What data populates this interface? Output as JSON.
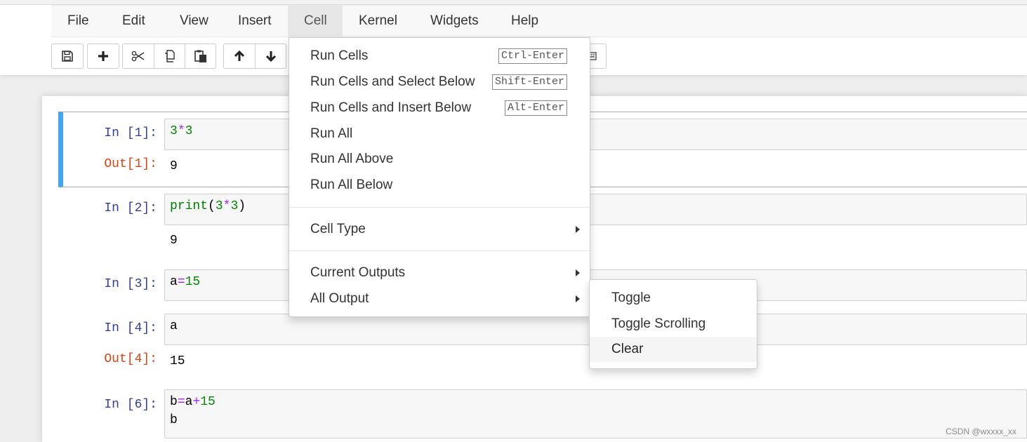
{
  "menubar": {
    "items": [
      "File",
      "Edit",
      "View",
      "Insert",
      "Cell",
      "Kernel",
      "Widgets",
      "Help"
    ],
    "active": "Cell"
  },
  "toolbar": {
    "icons": [
      "save-icon",
      "plus-icon",
      "scissors-icon",
      "copy-icon",
      "paste-icon",
      "arrow-up-icon",
      "arrow-down-icon",
      "keyboard-icon"
    ]
  },
  "cells": [
    {
      "in_prompt": "In [1]:",
      "code": [
        [
          "3",
          "*",
          "3"
        ]
      ],
      "out_prompt": "Out[1]:",
      "output": "9",
      "selected": true
    },
    {
      "in_prompt": "In [2]:",
      "code": [
        [
          "print",
          "(",
          "3",
          "*",
          "3",
          ")"
        ]
      ],
      "out_prompt": "",
      "output": "9"
    },
    {
      "in_prompt": "In [3]:",
      "code": [
        [
          "a",
          "=",
          "15"
        ]
      ]
    },
    {
      "in_prompt": "In [4]:",
      "code": [
        [
          "a"
        ]
      ],
      "out_prompt": "Out[4]:",
      "output": "15"
    },
    {
      "in_prompt": "In [6]:",
      "code": [
        [
          "b",
          "=",
          "a",
          "+",
          "15"
        ],
        [
          "b"
        ]
      ]
    }
  ],
  "cell_menu": {
    "items": [
      {
        "label": "Run Cells",
        "shortcut": "Ctrl-Enter"
      },
      {
        "label": "Run Cells and Select Below",
        "shortcut": "Shift-Enter"
      },
      {
        "label": "Run Cells and Insert Below",
        "shortcut": "Alt-Enter"
      },
      {
        "label": "Run All"
      },
      {
        "label": "Run All Above"
      },
      {
        "label": "Run All Below"
      },
      {
        "label": "Cell Type"
      },
      {
        "label": "Current Outputs"
      },
      {
        "label": "All Output"
      }
    ]
  },
  "all_output_submenu": {
    "items": [
      "Toggle",
      "Toggle Scrolling",
      "Clear"
    ],
    "hovered": "Clear"
  },
  "watermark": "CSDN @wxxxx_xx"
}
